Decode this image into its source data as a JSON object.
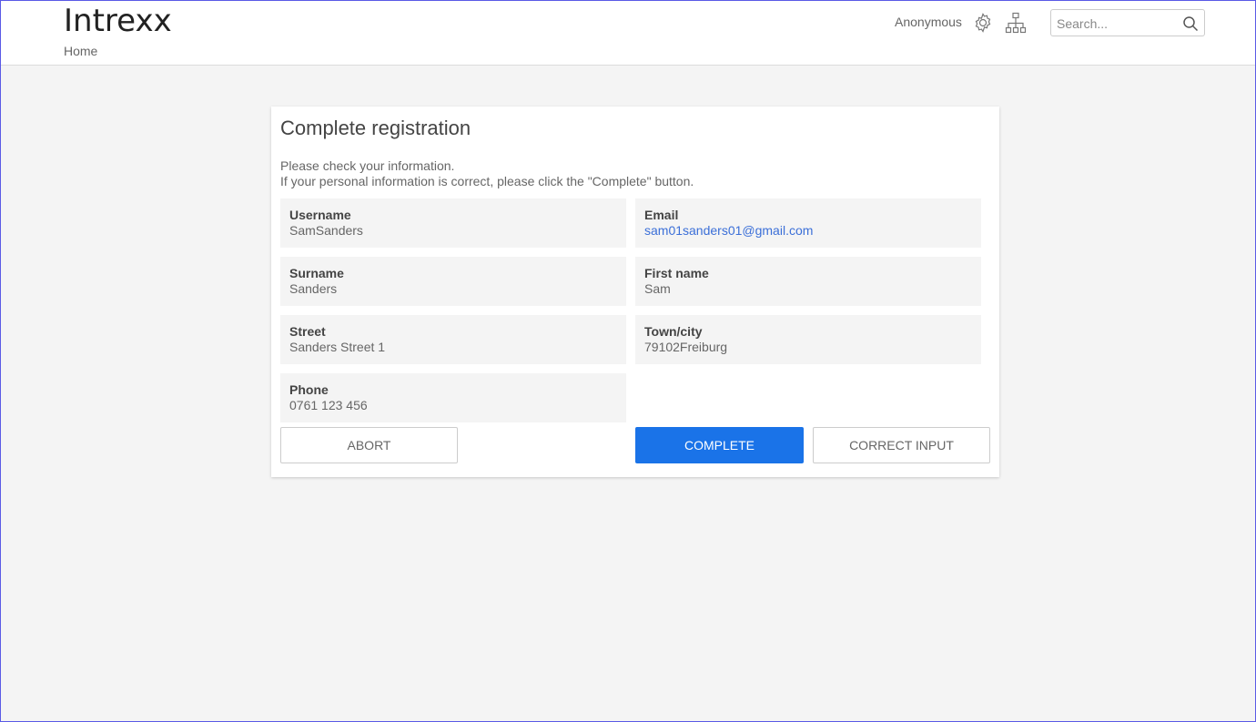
{
  "header": {
    "logo_text": "Intrexx",
    "breadcrumb": "Home",
    "user": "Anonymous",
    "settings_icon": "gear-icon",
    "sitemap_icon": "sitemap-icon",
    "search": {
      "placeholder": "Search...",
      "value": "",
      "icon": "search-icon"
    }
  },
  "card": {
    "title": "Complete registration",
    "intro_line1": "Please check your information.",
    "intro_line2": "If your personal information is correct, please click the \"Complete\" button.",
    "fields": {
      "username": {
        "label": "Username",
        "value": "SamSanders"
      },
      "email": {
        "label": "Email",
        "value": "sam01sanders01@gmail.com"
      },
      "surname": {
        "label": "Surname",
        "value": "Sanders"
      },
      "first_name": {
        "label": "First name",
        "value": "Sam"
      },
      "street": {
        "label": "Street",
        "value": "Sanders Street 1"
      },
      "town": {
        "label": "Town/city",
        "value": "79102Freiburg"
      },
      "phone": {
        "label": "Phone",
        "value": "0761 123 456"
      }
    },
    "buttons": {
      "abort": "ABORT",
      "complete": "COMPLETE",
      "correct": "CORRECT INPUT"
    }
  },
  "colors": {
    "accent": "#1a73e8",
    "link": "#3b6fd8",
    "background": "#f4f4f4"
  }
}
